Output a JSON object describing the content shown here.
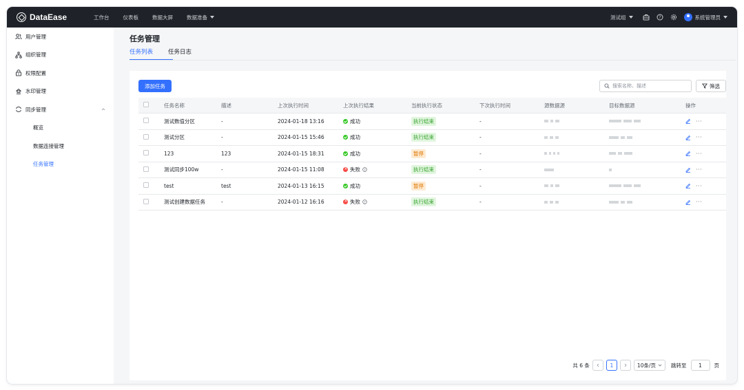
{
  "topbar": {
    "brand": "DataEase",
    "nav": [
      "工作台",
      "仪表板",
      "数据大屏",
      "数据准备"
    ],
    "group": "测试组",
    "user": "系统管理员"
  },
  "sidebar": {
    "items": [
      {
        "label": "用户管理",
        "icon": "users-icon"
      },
      {
        "label": "组织管理",
        "icon": "org-icon"
      },
      {
        "label": "权限配置",
        "icon": "lock-icon"
      },
      {
        "label": "水印管理",
        "icon": "watermark-icon"
      },
      {
        "label": "同步管理",
        "icon": "sync-icon"
      }
    ],
    "sub_items": [
      "概览",
      "数据连接管理",
      "任务管理"
    ]
  },
  "main": {
    "title": "任务管理",
    "tabs": [
      "任务列表",
      "任务日志"
    ],
    "add_button": "添加任务",
    "search_placeholder": "搜索名称、描述",
    "filter_button": "筛选",
    "columns": [
      "任务名称",
      "描述",
      "上次执行时间",
      "上次执行结果",
      "当前执行状态",
      "下次执行时间",
      "源数据源",
      "目标数据源",
      "操作"
    ],
    "rows": [
      {
        "name": "测试数值分区",
        "desc": "-",
        "last_time": "2024-01-18 13:16",
        "result": "成功",
        "status": "执行结束",
        "next_time": "-"
      },
      {
        "name": "测试分区",
        "desc": "-",
        "last_time": "2024-01-15 15:46",
        "result": "成功",
        "status": "执行结束",
        "next_time": "-"
      },
      {
        "name": "123",
        "desc": "123",
        "last_time": "2024-01-15 18:31",
        "result": "成功",
        "status": "暂停",
        "next_time": "-"
      },
      {
        "name": "测试同步100w",
        "desc": "-",
        "last_time": "2024-01-15 11:08",
        "result": "失败",
        "status": "执行结束",
        "next_time": "-"
      },
      {
        "name": "test",
        "desc": "test",
        "last_time": "2024-01-13 16:15",
        "result": "成功",
        "status": "暂停",
        "next_time": "-"
      },
      {
        "name": "测试创建数据任务",
        "desc": "-",
        "last_time": "2024-01-12 16:16",
        "result": "失败",
        "status": "执行结束",
        "next_time": "-"
      }
    ]
  },
  "pagination": {
    "total_prefix": "共",
    "total": "6",
    "total_suffix": "条",
    "current_page": "1",
    "page_size": "10条/页",
    "jump_label": "跳转至",
    "jump_value": "1",
    "page_suffix": "页"
  },
  "colors": {
    "accent": "#3370ff",
    "topbar": "#1f2329",
    "success": "#34c724",
    "fail": "#f54a45",
    "tag_done_bg": "#e1f5df",
    "tag_pause_bg": "#feead2"
  }
}
